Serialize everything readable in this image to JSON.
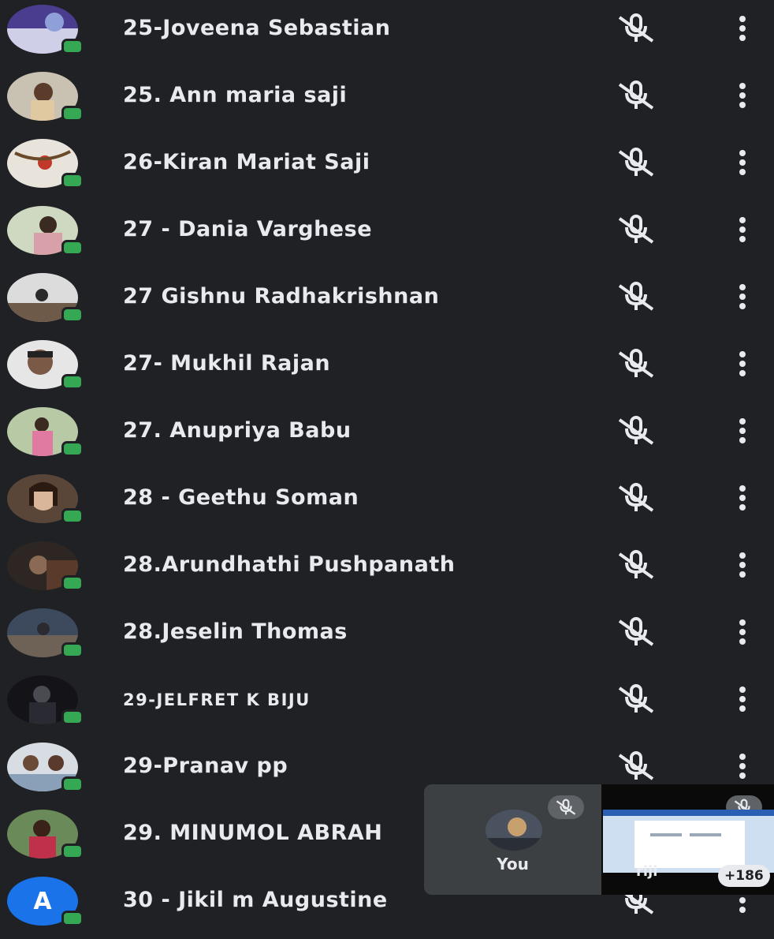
{
  "colors": {
    "background": "#202124",
    "text": "#e8eaed",
    "online": "#34a853",
    "tile": "#3c4043"
  },
  "participants": [
    {
      "name": "25-Joveena Sebastian",
      "avatar": "photo"
    },
    {
      "name": "25. Ann maria saji",
      "avatar": "photo"
    },
    {
      "name": "26-Kiran Mariat Saji",
      "avatar": "photo"
    },
    {
      "name": "27 - Dania Varghese",
      "avatar": "photo"
    },
    {
      "name": "27 Gishnu Radhakrishnan",
      "avatar": "photo"
    },
    {
      "name": "27- Mukhil Rajan",
      "avatar": "photo"
    },
    {
      "name": "27. Anupriya Babu",
      "avatar": "photo"
    },
    {
      "name": "28 - Geethu Soman",
      "avatar": "photo"
    },
    {
      "name": "28.Arundhathi Pushpanath",
      "avatar": "photo"
    },
    {
      "name": "28.Jeselin Thomas",
      "avatar": "photo"
    },
    {
      "name": "29-JELFRET K BIJU",
      "avatar": "photo"
    },
    {
      "name": "29-Pranav pp",
      "avatar": "photo"
    },
    {
      "name": "29. MINUMOL ABRAH",
      "avatar": "photo"
    },
    {
      "name": "30 - Jikil m Augustine",
      "avatar": "A"
    }
  ],
  "icons": {
    "mic": "mic-off-icon",
    "more": "more-vert-icon"
  },
  "self_tile": {
    "label": "You"
  },
  "screen_tile": {
    "label": "riji",
    "badge": "+186"
  }
}
